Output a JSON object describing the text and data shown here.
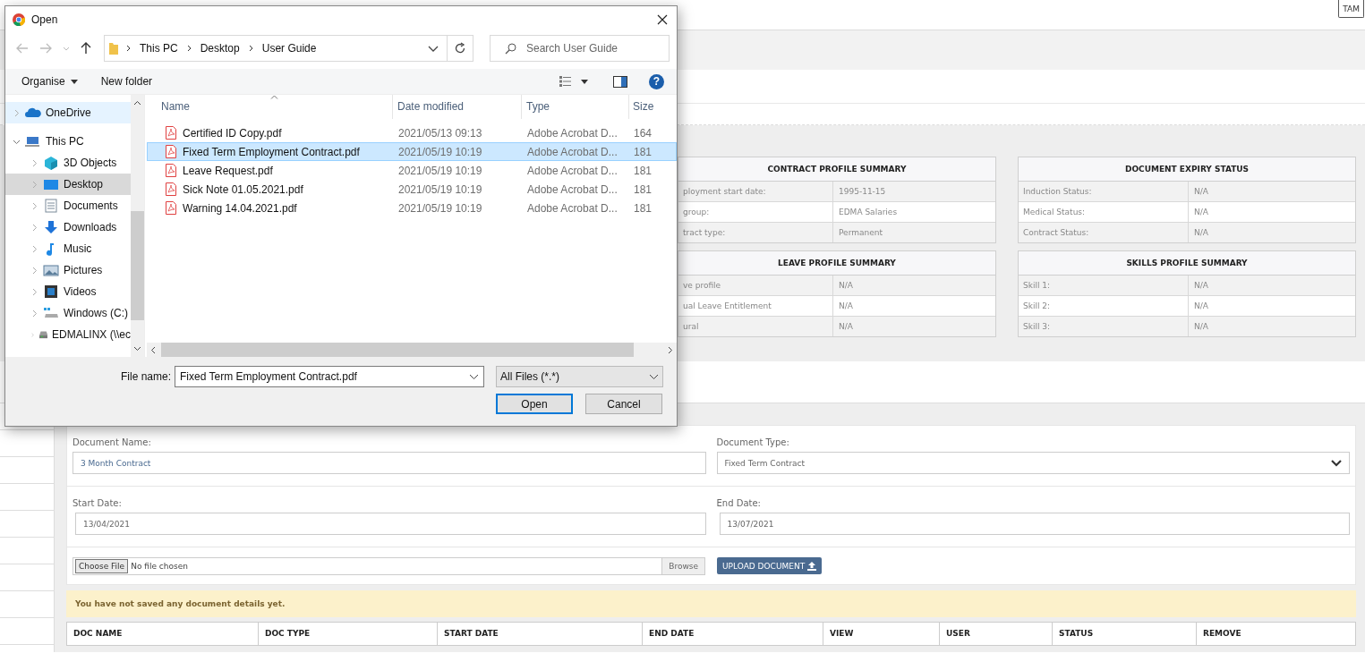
{
  "header": {
    "user_button": "TAM"
  },
  "summary_tables": [
    {
      "title": "CONTRACT PROFILE SUMMARY",
      "rows": [
        {
          "label": "ployment start date:",
          "value": "1995-11-15"
        },
        {
          "label": "group:",
          "value": "EDMA Salaries"
        },
        {
          "label": "tract type:",
          "value": "Permanent"
        }
      ]
    },
    {
      "title": "DOCUMENT EXPIRY STATUS",
      "rows": [
        {
          "label": "Induction Status:",
          "value": "N/A"
        },
        {
          "label": "Medical Status:",
          "value": "N/A"
        },
        {
          "label": "Contract Status:",
          "value": "N/A"
        }
      ]
    },
    {
      "title": "LEAVE PROFILE SUMMARY",
      "rows": [
        {
          "label": "ve profile",
          "value": "N/A"
        },
        {
          "label": "ual Leave Entitlement",
          "value": "N/A"
        },
        {
          "label": "ural",
          "value": "N/A"
        }
      ]
    },
    {
      "title": "SKILLS PROFILE SUMMARY",
      "rows": [
        {
          "label": "Skill 1:",
          "value": "N/A"
        },
        {
          "label": "Skill 2:",
          "value": "N/A"
        },
        {
          "label": "Skill 3:",
          "value": "N/A"
        }
      ]
    }
  ],
  "document_form": {
    "fields": [
      {
        "label": "Document Name:",
        "value": "3 Month Contract",
        "kind": "text"
      },
      {
        "label": "Document Type:",
        "value": "Fixed Term Contract",
        "kind": "select"
      },
      {
        "label": "Start Date:",
        "value": "13/04/2021",
        "kind": "text"
      },
      {
        "label": "End Date:",
        "value": "13/07/2021",
        "kind": "text"
      }
    ],
    "file_input": {
      "button": "Choose File",
      "status": "No file chosen",
      "browse": "Browse"
    },
    "upload_button": "UPLOAD DOCUMENT"
  },
  "alert": "You have not saved any document details yet.",
  "documents_table": {
    "columns": [
      "DOC NAME",
      "DOC TYPE",
      "START DATE",
      "END DATE",
      "VIEW",
      "USER",
      "STATUS",
      "REMOVE"
    ]
  },
  "dialog": {
    "title": "Open",
    "path": [
      "This PC",
      "Desktop",
      "User Guide"
    ],
    "search_placeholder": "Search User Guide",
    "toolbar": {
      "organise": "Organise",
      "new_folder": "New folder",
      "help": "?"
    },
    "nav": [
      {
        "label": "OneDrive",
        "kind": "cloud",
        "selected": false,
        "hovered": true,
        "expanded": false
      },
      {
        "label": "This PC",
        "kind": "computer",
        "selected": false,
        "hovered": false,
        "expanded": true,
        "children": [
          {
            "label": "3D Objects",
            "kind": "cube",
            "selected": false,
            "hovered": false,
            "expanded": false
          },
          {
            "label": "Desktop",
            "kind": "desktop",
            "selected": true,
            "hovered": false,
            "expanded": false
          },
          {
            "label": "Documents",
            "kind": "document",
            "selected": false,
            "hovered": false,
            "expanded": false
          },
          {
            "label": "Downloads",
            "kind": "download",
            "selected": false,
            "hovered": false,
            "expanded": false
          },
          {
            "label": "Music",
            "kind": "music",
            "selected": false,
            "hovered": false,
            "expanded": false
          },
          {
            "label": "Pictures",
            "kind": "pictures",
            "selected": false,
            "hovered": false,
            "expanded": false
          },
          {
            "label": "Videos",
            "kind": "video",
            "selected": false,
            "hovered": false,
            "expanded": false
          },
          {
            "label": "Windows (C:)",
            "kind": "drive",
            "selected": false,
            "hovered": false,
            "expanded": false
          },
          {
            "label": "EDMALINX (\\\\ec",
            "kind": "network",
            "selected": false,
            "hovered": false,
            "expanded": false
          }
        ]
      }
    ],
    "columns": [
      "Name",
      "Date modified",
      "Type",
      "Size"
    ],
    "files": [
      {
        "name": "Certified ID Copy.pdf",
        "date": "2021/05/13 09:13",
        "type": "Adobe Acrobat D...",
        "size": "164",
        "selected": false
      },
      {
        "name": "Fixed Term Employment Contract.pdf",
        "date": "2021/05/19 10:19",
        "type": "Adobe Acrobat D...",
        "size": "181",
        "selected": true
      },
      {
        "name": "Leave Request.pdf",
        "date": "2021/05/19 10:19",
        "type": "Adobe Acrobat D...",
        "size": "181",
        "selected": false
      },
      {
        "name": "Sick Note 01.05.2021.pdf",
        "date": "2021/05/19 10:19",
        "type": "Adobe Acrobat D...",
        "size": "181",
        "selected": false
      },
      {
        "name": "Warning 14.04.2021.pdf",
        "date": "2021/05/19 10:19",
        "type": "Adobe Acrobat D...",
        "size": "181",
        "selected": false
      }
    ],
    "file_name_label": "File name:",
    "file_name": "Fixed Term Employment Contract.pdf",
    "file_type": "All Files (*.*)",
    "buttons": [
      {
        "label": "Open",
        "kind": "primary"
      },
      {
        "label": "Cancel",
        "kind": "secondary"
      }
    ]
  }
}
